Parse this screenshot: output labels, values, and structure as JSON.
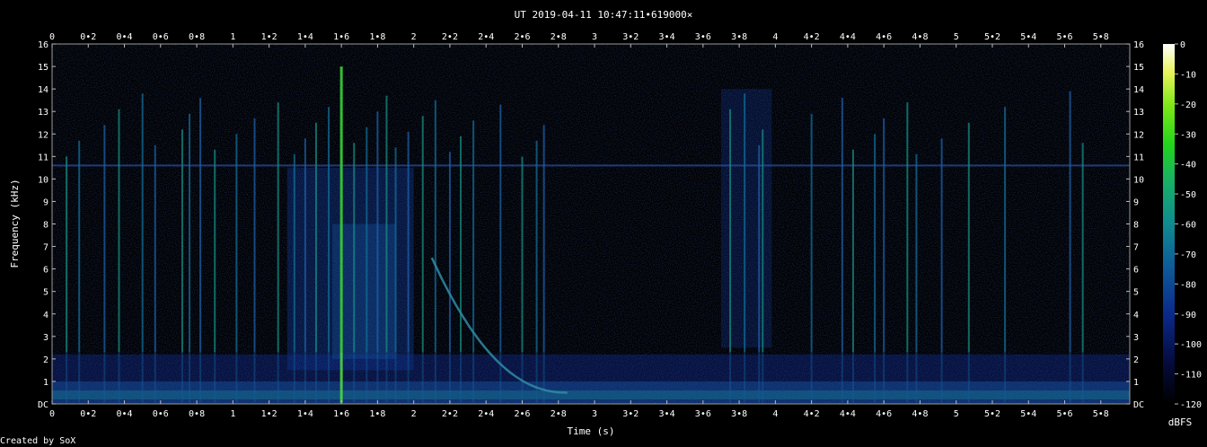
{
  "chart_data": {
    "type": "heatmap",
    "title": "UT 2019-04-11 10:47:11•619000×",
    "xlabel": "Time (s)",
    "ylabel": "Frequency (kHz)",
    "xlim": [
      0,
      5.96
    ],
    "ylim": [
      0,
      16
    ],
    "x_ticks": [
      "0",
      "0•2",
      "0•4",
      "0•6",
      "0•8",
      "1",
      "1•2",
      "1•4",
      "1•6",
      "1•8",
      "2",
      "2•2",
      "2•4",
      "2•6",
      "2•8",
      "3",
      "3•2",
      "3•4",
      "3•6",
      "3•8",
      "4",
      "4•2",
      "4•4",
      "4•6",
      "4•8",
      "5",
      "5•2",
      "5•4",
      "5•6",
      "5•8"
    ],
    "y_ticks": [
      "DC",
      "1",
      "2",
      "3",
      "4",
      "5",
      "6",
      "7",
      "8",
      "9",
      "10",
      "11",
      "12",
      "13",
      "14",
      "15",
      "16"
    ],
    "colorbar": {
      "label": "dBFS",
      "range": [
        -120,
        0
      ],
      "ticks": [
        "0",
        "-10",
        "-20",
        "-30",
        "-40",
        "-50",
        "-60",
        "-70",
        "-80",
        "-90",
        "-100",
        "-110",
        "-120"
      ]
    },
    "grid": false,
    "features": {
      "background_tone_khz": 10.6,
      "strongest_impulse_s": 1.6,
      "impulse_times_s": [
        0.08,
        0.15,
        0.29,
        0.37,
        0.5,
        0.57,
        0.72,
        0.76,
        0.82,
        0.9,
        1.02,
        1.12,
        1.25,
        1.34,
        1.4,
        1.46,
        1.53,
        1.6,
        1.67,
        1.74,
        1.8,
        1.85,
        1.9,
        1.97,
        2.05,
        2.12,
        2.2,
        2.26,
        2.33,
        2.48,
        2.6,
        2.68,
        2.72,
        3.75,
        3.83,
        3.91,
        3.93,
        4.2,
        4.37,
        4.43,
        4.55,
        4.6,
        4.73,
        4.78,
        4.92,
        5.07,
        5.27,
        5.63,
        5.7
      ],
      "sweep": {
        "t_start": 2.1,
        "t_end": 2.85,
        "f_start_khz": 6.5,
        "f_end_khz": 0.5
      }
    }
  },
  "footer": {
    "credit": "Created by SoX"
  }
}
